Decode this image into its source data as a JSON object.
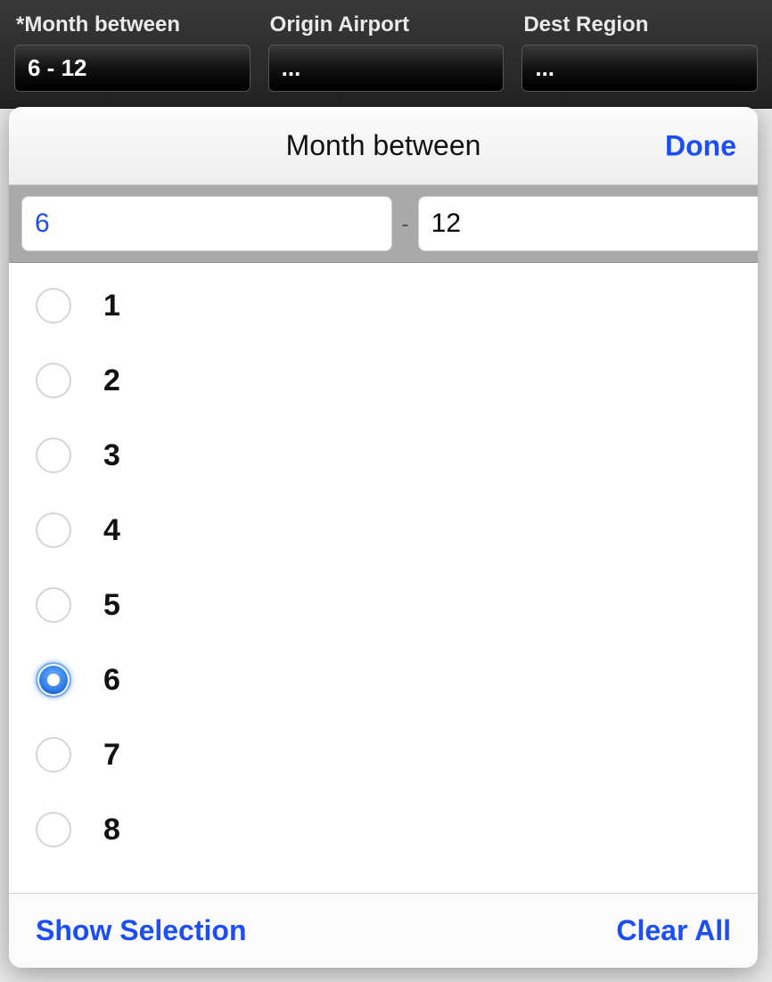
{
  "filters": [
    {
      "label": "*Month between",
      "value": "6 - 12",
      "active": true
    },
    {
      "label": "Origin Airport",
      "value": "...",
      "active": false
    },
    {
      "label": "Dest Region",
      "value": "...",
      "active": false
    }
  ],
  "popover": {
    "title": "Month between",
    "done_label": "Done",
    "range": {
      "from": "6",
      "to": "12",
      "dash": "-"
    },
    "options": [
      {
        "label": "1",
        "selected": false
      },
      {
        "label": "2",
        "selected": false
      },
      {
        "label": "3",
        "selected": false
      },
      {
        "label": "4",
        "selected": false
      },
      {
        "label": "5",
        "selected": false
      },
      {
        "label": "6",
        "selected": true
      },
      {
        "label": "7",
        "selected": false
      },
      {
        "label": "8",
        "selected": false
      }
    ],
    "footer": {
      "show_selection_label": "Show Selection",
      "clear_all_label": "Clear All"
    }
  }
}
